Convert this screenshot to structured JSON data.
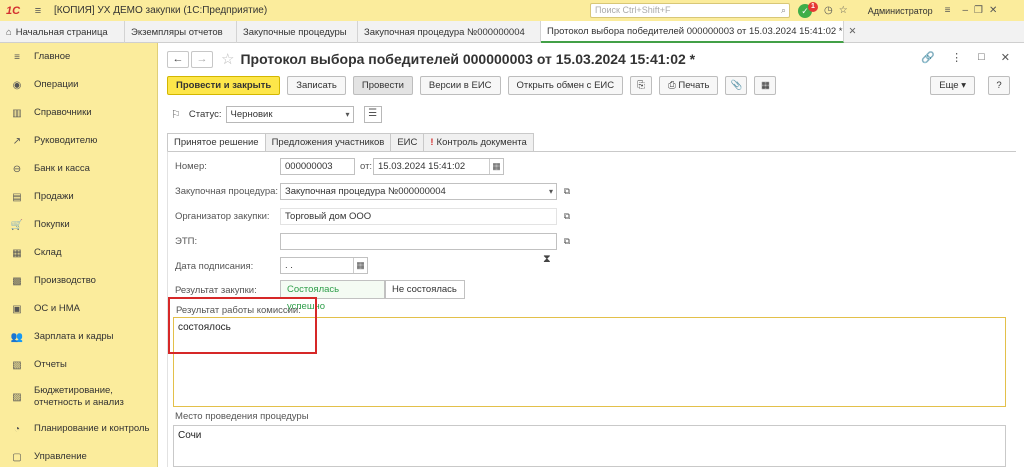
{
  "titlebar": {
    "logo": "1С",
    "title": "[КОПИЯ] УХ ДЕМО закупки  (1С:Предприятие)",
    "search_placeholder": "Поиск Ctrl+Shift+F",
    "notifications": "1",
    "user": "Администратор"
  },
  "tabs": [
    {
      "label": "Начальная страница"
    },
    {
      "label": "Экземпляры отчетов"
    },
    {
      "label": "Закупочные процедуры"
    },
    {
      "label": "Закупочная процедура №000000004"
    },
    {
      "label": "Протокол выбора победителей 000000003 от 15.03.2024 15:41:02 *"
    }
  ],
  "sidebar": {
    "items": [
      {
        "label": "Главное",
        "icon": "≡"
      },
      {
        "label": "Операции",
        "icon": "◉"
      },
      {
        "label": "Справочники",
        "icon": "▥"
      },
      {
        "label": "Руководителю",
        "icon": "↗"
      },
      {
        "label": "Банк и касса",
        "icon": "⊖"
      },
      {
        "label": "Продажи",
        "icon": "▤"
      },
      {
        "label": "Покупки",
        "icon": "🛒"
      },
      {
        "label": "Склад",
        "icon": "▦"
      },
      {
        "label": "Производство",
        "icon": "▩"
      },
      {
        "label": "ОС и НМА",
        "icon": "▣"
      },
      {
        "label": "Зарплата и кадры",
        "icon": "👥"
      },
      {
        "label": "Отчеты",
        "icon": "▧"
      },
      {
        "label": "Бюджетирование, отчетность и анализ",
        "icon": "▨"
      },
      {
        "label": "Планирование и контроль",
        "icon": "◔"
      },
      {
        "label": "Управление",
        "icon": "▢"
      }
    ]
  },
  "document": {
    "title": "Протокол выбора победителей 000000003 от 15.03.2024 15:41:02 *",
    "toolbar": {
      "post_close": "Провести и закрыть",
      "save": "Записать",
      "post": "Провести",
      "versions": "Версии в ЕИС",
      "open_exchange": "Открыть обмен с ЕИС",
      "print": "Печать",
      "more": "Еще",
      "help": "?"
    },
    "status_label": "Статус:",
    "status_value": "Черновик",
    "tabs": [
      "Принятое решение",
      "Предложения участников",
      "ЕИС",
      "Контроль документа"
    ],
    "fields": {
      "number_label": "Номер:",
      "number_value": "000000003",
      "date_label": "от:",
      "date_value": "15.03.2024 15:41:02",
      "procedure_label": "Закупочная процедура:",
      "procedure_value": "Закупочная процедура №000000004",
      "organizer_label": "Организатор закупки:",
      "organizer_value": "Торговый дом ООО",
      "etp_label": "ЭТП:",
      "etp_value": "",
      "sign_date_label": "Дата подписания:",
      "sign_date_value": " .  .",
      "result_label": "Результат закупки:",
      "result_success": "Состоялась успешно",
      "result_fail": "Не состоялась",
      "commission_label": "Результат работы комиссии:",
      "commission_value": "состоялось",
      "place_label": "Место проведения процедуры",
      "place_value": "Сочи"
    }
  }
}
